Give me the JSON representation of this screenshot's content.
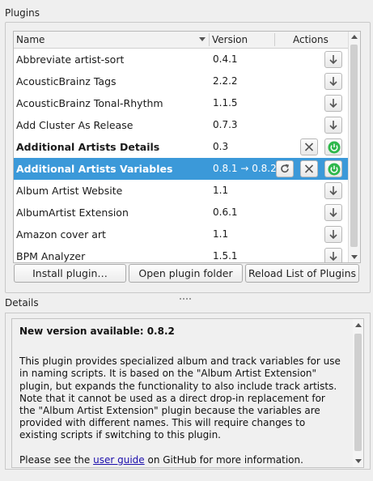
{
  "plugins_group": {
    "title": "Plugins"
  },
  "table": {
    "headers": {
      "name": "Name",
      "version": "Version",
      "actions": "Actions"
    },
    "rows": [
      {
        "name": "Abbreviate artist-sort",
        "version": "0.4.1",
        "bold": false,
        "selected": false,
        "actions": [
          "download"
        ]
      },
      {
        "name": "AcousticBrainz Tags",
        "version": "2.2.2",
        "bold": false,
        "selected": false,
        "actions": [
          "download"
        ]
      },
      {
        "name": "AcousticBrainz Tonal-Rhythm",
        "version": "1.1.5",
        "bold": false,
        "selected": false,
        "actions": [
          "download"
        ]
      },
      {
        "name": "Add Cluster As Release",
        "version": "0.7.3",
        "bold": false,
        "selected": false,
        "actions": [
          "download"
        ]
      },
      {
        "name": "Additional Artists Details",
        "version": "0.3",
        "bold": true,
        "selected": false,
        "actions": [
          "uninstall",
          "enable"
        ]
      },
      {
        "name": "Additional Artists Variables",
        "version": "0.8.1 → 0.8.2",
        "bold": true,
        "selected": true,
        "actions": [
          "update",
          "uninstall",
          "enable"
        ]
      },
      {
        "name": "Album Artist Website",
        "version": "1.1",
        "bold": false,
        "selected": false,
        "actions": [
          "download"
        ]
      },
      {
        "name": "AlbumArtist Extension",
        "version": "0.6.1",
        "bold": false,
        "selected": false,
        "actions": [
          "download"
        ]
      },
      {
        "name": "Amazon cover art",
        "version": "1.1",
        "bold": false,
        "selected": false,
        "actions": [
          "download"
        ]
      },
      {
        "name": "BPM Analyzer",
        "version": "1.5.1",
        "bold": false,
        "selected": false,
        "actions": [
          "download"
        ]
      }
    ]
  },
  "buttons": {
    "install": "Install plugin…",
    "open_folder": "Open plugin folder",
    "reload": "Reload List of Plugins"
  },
  "details_group": {
    "title": "Details",
    "heading": "New version available: 0.8.2",
    "description": "This plugin provides specialized album and track variables for use in naming scripts. It is based on the \"Album Artist Extension\" plugin, but expands the functionality to also include track artists. Note that it cannot be used as a direct drop-in replacement for the \"Album Artist Extension\" plugin because the variables are provided with different names. This will require changes to existing scripts if switching to this plugin.",
    "footer_prefix": "Please see the ",
    "footer_link": "user guide",
    "footer_suffix": " on GitHub for more information."
  },
  "colors": {
    "selection": "#3b99d9",
    "enabled_green": "#2eb84b"
  },
  "icons": {
    "download": "arrow-down-icon",
    "uninstall": "close-icon",
    "enable": "power-icon",
    "update": "refresh-icon"
  }
}
